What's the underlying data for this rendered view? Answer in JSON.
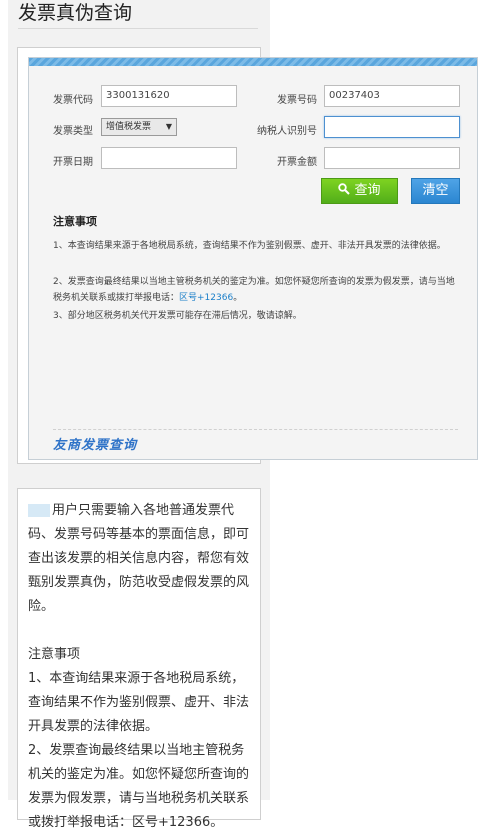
{
  "header": {
    "title": "发票真伪查询"
  },
  "form": {
    "invoice_code": {
      "label": "发票代码",
      "value": "3300131620"
    },
    "invoice_number": {
      "label": "发票号码",
      "value": "00237403"
    },
    "invoice_type": {
      "label": "发票类型",
      "selected": "增值税发票"
    },
    "taxpayer_id": {
      "label": "纳税人识别号",
      "value": ""
    },
    "issue_date": {
      "label": "开票日期",
      "value": ""
    },
    "amount": {
      "label": "开票金额",
      "value": ""
    },
    "query_label": "查询",
    "clear_label": "清空",
    "accent_green": "#5ec21e",
    "accent_blue": "#3a93dc"
  },
  "notice": {
    "title": "注意事项",
    "item1": "1、本查询结果来源于各地税局系统，查询结果不作为鉴别假票、虚开、非法开具发票的法律依据。",
    "item2_pre": "2、发票查询最终结果以当地主管税务机关的鉴定为准。如您怀疑您所查询的发票为假发票，请与当地税务机关联系或拨打举报电话：",
    "item2_link": "区号+12366",
    "item2_post": "。",
    "item3": "3、部分地区税务机关代开发票可能存在滞后情况，敬请谅解。"
  },
  "brand": {
    "logo": "友商发票查询"
  },
  "info": {
    "intro": "用户只需要输入各地普通发票代码、发票号码等基本的票面信息，即可查出该发票的相关信息内容，帮您有效甄别发票真伪，防范收受虚假发票的风险。",
    "notice_heading": "注意事项",
    "p1": "1、本查询结果来源于各地税局系统，查询结果不作为鉴别假票、虚开、非法开具发票的法律依据。",
    "p2": "2、发票查询最终结果以当地主管税务机关的鉴定为准。如您怀疑您所查询的发票为假发票，请与当地税务机关联系或拨打举报电话：区号+12366。"
  }
}
